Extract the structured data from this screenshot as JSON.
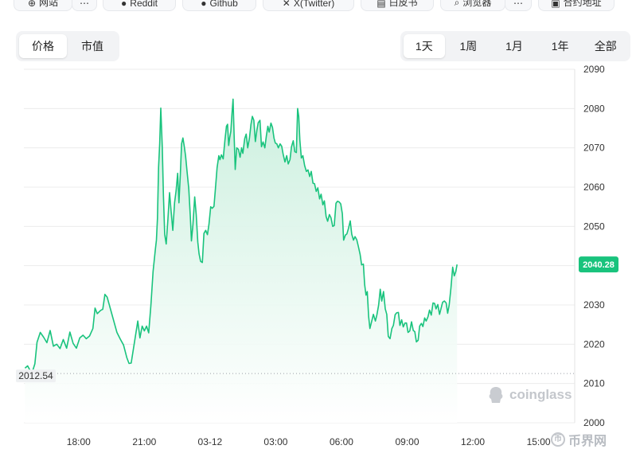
{
  "top_links": [
    {
      "label": "网站",
      "icon": "globe-icon"
    },
    {
      "label": "",
      "icon": "more-icon"
    },
    {
      "label": "Reddit",
      "icon": "reddit-icon"
    },
    {
      "label": "Github",
      "icon": "github-icon"
    },
    {
      "label": "X(Twitter)",
      "icon": "x-icon"
    },
    {
      "label": "白皮书",
      "icon": "document-icon"
    },
    {
      "label": "浏览器",
      "icon": "search-icon"
    },
    {
      "label": "",
      "icon": "more-icon"
    },
    {
      "label": "合约地址",
      "icon": "clipboard-icon"
    }
  ],
  "metric_tabs": [
    {
      "label": "价格",
      "active": true
    },
    {
      "label": "市值",
      "active": false
    }
  ],
  "range_tabs": [
    {
      "label": "1天",
      "active": true
    },
    {
      "label": "1周",
      "active": false
    },
    {
      "label": "1月",
      "active": false
    },
    {
      "label": "1年",
      "active": false
    },
    {
      "label": "全部",
      "active": false
    }
  ],
  "watermark": {
    "text": "coinglass",
    "icon": "coinglass-logo-icon"
  },
  "site_mark": {
    "text": "币界网",
    "icon": "coin-icon"
  },
  "colors": {
    "line": "#19c37d",
    "area_top": "#c9efdd",
    "area_bottom": "#ffffff",
    "badge": "#19c37d",
    "grid": "#ececec"
  },
  "chart_data": {
    "type": "area",
    "title": "",
    "xlabel": "",
    "ylabel": "",
    "ylim": [
      2000,
      2090
    ],
    "y_ticks": [
      2090,
      2080,
      2070,
      2060,
      2050,
      2040,
      2030,
      2020,
      2010,
      2000
    ],
    "y_axis_side": "right",
    "grid": true,
    "x_ticks": [
      {
        "label": "18:00",
        "x": 3
      },
      {
        "label": "21:00",
        "x": 6
      },
      {
        "label": "03-12",
        "x": 9
      },
      {
        "label": "03:00",
        "x": 12
      },
      {
        "label": "06:00",
        "x": 15
      },
      {
        "label": "09:00",
        "x": 18
      },
      {
        "label": "12:00",
        "x": 21
      },
      {
        "label": "15:00",
        "x": 24
      }
    ],
    "x_range": [
      0.5,
      25.65
    ],
    "last_value_label": "2040.28",
    "baseline": {
      "value": 2012.54,
      "label": "2012.54"
    },
    "series": [
      {
        "name": "",
        "points": [
          [
            0.55,
            2013.9
          ],
          [
            0.67,
            2014.5
          ],
          [
            0.86,
            2012.5
          ],
          [
            1.0,
            2015.0
          ],
          [
            1.1,
            2020.5
          ],
          [
            1.25,
            2023.0
          ],
          [
            1.4,
            2021.8
          ],
          [
            1.55,
            2020.4
          ],
          [
            1.7,
            2023.5
          ],
          [
            1.85,
            2019.5
          ],
          [
            2.0,
            2020.0
          ],
          [
            2.15,
            2018.9
          ],
          [
            2.3,
            2021.2
          ],
          [
            2.45,
            2019.0
          ],
          [
            2.6,
            2023.1
          ],
          [
            2.75,
            2020.2
          ],
          [
            2.9,
            2019.0
          ],
          [
            3.05,
            2021.6
          ],
          [
            3.2,
            2022.3
          ],
          [
            3.35,
            2021.4
          ],
          [
            3.5,
            2022.1
          ],
          [
            3.65,
            2024.0
          ],
          [
            3.75,
            2029.2
          ],
          [
            3.85,
            2027.8
          ],
          [
            4.0,
            2028.6
          ],
          [
            4.1,
            2028.9
          ],
          [
            4.2,
            2032.7
          ],
          [
            4.3,
            2032.0
          ],
          [
            4.45,
            2029.0
          ],
          [
            4.6,
            2026.0
          ],
          [
            4.75,
            2023.0
          ],
          [
            4.9,
            2021.3
          ],
          [
            5.05,
            2019.8
          ],
          [
            5.2,
            2016.6
          ],
          [
            5.3,
            2015.1
          ],
          [
            5.4,
            2015.2
          ],
          [
            5.55,
            2020.6
          ],
          [
            5.7,
            2025.9
          ],
          [
            5.8,
            2021.6
          ],
          [
            5.9,
            2024.6
          ],
          [
            6.0,
            2023.4
          ],
          [
            6.1,
            2024.6
          ],
          [
            6.2,
            2022.9
          ],
          [
            6.3,
            2030.0
          ],
          [
            6.4,
            2038.5
          ],
          [
            6.5,
            2044.0
          ],
          [
            6.55,
            2046.5
          ],
          [
            6.6,
            2052.0
          ],
          [
            6.65,
            2065.0
          ],
          [
            6.7,
            2071.0
          ],
          [
            6.75,
            2080.1
          ],
          [
            6.82,
            2070.0
          ],
          [
            6.87,
            2058.0
          ],
          [
            6.93,
            2048.0
          ],
          [
            7.0,
            2045.5
          ],
          [
            7.08,
            2052.0
          ],
          [
            7.15,
            2058.6
          ],
          [
            7.22,
            2054.0
          ],
          [
            7.3,
            2049.0
          ],
          [
            7.38,
            2056.0
          ],
          [
            7.45,
            2059.0
          ],
          [
            7.52,
            2063.5
          ],
          [
            7.58,
            2056.0
          ],
          [
            7.64,
            2063.0
          ],
          [
            7.7,
            2071.0
          ],
          [
            7.76,
            2072.5
          ],
          [
            7.82,
            2070.5
          ],
          [
            7.88,
            2068.0
          ],
          [
            7.95,
            2064.0
          ],
          [
            8.03,
            2059.5
          ],
          [
            8.1,
            2052.5
          ],
          [
            8.15,
            2046.3
          ],
          [
            8.22,
            2050.5
          ],
          [
            8.3,
            2057.5
          ],
          [
            8.37,
            2053.0
          ],
          [
            8.44,
            2046.0
          ],
          [
            8.5,
            2043.0
          ],
          [
            8.57,
            2041.1
          ],
          [
            8.65,
            2040.8
          ],
          [
            8.72,
            2048.2
          ],
          [
            8.8,
            2049.0
          ],
          [
            8.88,
            2047.9
          ],
          [
            8.95,
            2050.5
          ],
          [
            9.03,
            2055.0
          ],
          [
            9.1,
            2054.6
          ],
          [
            9.18,
            2055.1
          ],
          [
            9.25,
            2060.0
          ],
          [
            9.32,
            2064.9
          ],
          [
            9.4,
            2068.0
          ],
          [
            9.45,
            2067.0
          ],
          [
            9.52,
            2068.2
          ],
          [
            9.6,
            2067.2
          ],
          [
            9.68,
            2072.0
          ],
          [
            9.75,
            2075.5
          ],
          [
            9.8,
            2076.0
          ],
          [
            9.85,
            2070.6
          ],
          [
            9.9,
            2072.6
          ],
          [
            9.95,
            2074.2
          ],
          [
            10.0,
            2078.6
          ],
          [
            10.05,
            2082.4
          ],
          [
            10.1,
            2073.4
          ],
          [
            10.15,
            2064.5
          ],
          [
            10.22,
            2070.0
          ],
          [
            10.3,
            2069.6
          ],
          [
            10.37,
            2067.6
          ],
          [
            10.44,
            2070.0
          ],
          [
            10.5,
            2068.6
          ],
          [
            10.58,
            2072.3
          ],
          [
            10.65,
            2073.5
          ],
          [
            10.72,
            2070.0
          ],
          [
            10.8,
            2072.5
          ],
          [
            10.87,
            2076.0
          ],
          [
            10.93,
            2078.0
          ],
          [
            11.0,
            2077.0
          ],
          [
            11.07,
            2071.6
          ],
          [
            11.14,
            2074.6
          ],
          [
            11.2,
            2076.4
          ],
          [
            11.28,
            2077.0
          ],
          [
            11.35,
            2070.3
          ],
          [
            11.42,
            2071.5
          ],
          [
            11.5,
            2070.0
          ],
          [
            11.57,
            2073.0
          ],
          [
            11.64,
            2075.5
          ],
          [
            11.7,
            2074.0
          ],
          [
            11.78,
            2076.3
          ],
          [
            11.85,
            2075.2
          ],
          [
            11.92,
            2072.5
          ],
          [
            11.98,
            2071.2
          ],
          [
            12.05,
            2071.0
          ],
          [
            12.12,
            2070.0
          ],
          [
            12.2,
            2071.0
          ],
          [
            12.27,
            2070.4
          ],
          [
            12.34,
            2068.3
          ],
          [
            12.42,
            2066.4
          ],
          [
            12.5,
            2068.0
          ],
          [
            12.57,
            2065.9
          ],
          [
            12.65,
            2067.0
          ],
          [
            12.72,
            2070.3
          ],
          [
            12.8,
            2071.8
          ],
          [
            12.87,
            2069.0
          ],
          [
            12.94,
            2068.8
          ],
          [
            13.0,
            2080.0
          ],
          [
            13.05,
            2078.0
          ],
          [
            13.1,
            2072.0
          ],
          [
            13.17,
            2067.4
          ],
          [
            13.24,
            2068.0
          ],
          [
            13.32,
            2065.5
          ],
          [
            13.4,
            2064.0
          ],
          [
            13.47,
            2064.4
          ],
          [
            13.55,
            2062.7
          ],
          [
            13.62,
            2064.0
          ],
          [
            13.7,
            2061.0
          ],
          [
            13.77,
            2060.9
          ],
          [
            13.85,
            2058.9
          ],
          [
            13.92,
            2059.8
          ],
          [
            14.0,
            2057.0
          ],
          [
            14.07,
            2058.2
          ],
          [
            14.15,
            2055.5
          ],
          [
            14.22,
            2056.5
          ],
          [
            14.3,
            2052.5
          ],
          [
            14.37,
            2051.3
          ],
          [
            14.45,
            2053.0
          ],
          [
            14.52,
            2052.2
          ],
          [
            14.6,
            2050.0
          ],
          [
            14.67,
            2050.2
          ],
          [
            14.75,
            2055.9
          ],
          [
            14.82,
            2056.4
          ],
          [
            14.9,
            2056.2
          ],
          [
            14.97,
            2055.7
          ],
          [
            15.04,
            2053.2
          ],
          [
            15.1,
            2046.5
          ],
          [
            15.18,
            2047.8
          ],
          [
            15.25,
            2048.1
          ],
          [
            15.32,
            2049.5
          ],
          [
            15.4,
            2051.4
          ],
          [
            15.47,
            2048.0
          ],
          [
            15.55,
            2046.5
          ],
          [
            15.62,
            2047.4
          ],
          [
            15.7,
            2046.6
          ],
          [
            15.77,
            2044.9
          ],
          [
            15.85,
            2042.9
          ],
          [
            15.92,
            2040.2
          ],
          [
            16.0,
            2040.4
          ],
          [
            16.06,
            2035.2
          ],
          [
            16.12,
            2032.5
          ],
          [
            16.18,
            2033.4
          ],
          [
            16.24,
            2027.1
          ],
          [
            16.3,
            2024.0
          ],
          [
            16.38,
            2025.8
          ],
          [
            16.46,
            2027.6
          ],
          [
            16.55,
            2025.9
          ],
          [
            16.62,
            2027.5
          ],
          [
            16.7,
            2030.0
          ],
          [
            16.77,
            2034.0
          ],
          [
            16.84,
            2031.0
          ],
          [
            16.92,
            2033.4
          ],
          [
            17.0,
            2029.0
          ],
          [
            17.07,
            2027.6
          ],
          [
            17.14,
            2022.0
          ],
          [
            17.22,
            2021.4
          ],
          [
            17.3,
            2024.0
          ],
          [
            17.37,
            2024.8
          ],
          [
            17.45,
            2027.5
          ],
          [
            17.52,
            2028.0
          ],
          [
            17.6,
            2028.1
          ],
          [
            17.67,
            2024.8
          ],
          [
            17.75,
            2026.2
          ],
          [
            17.82,
            2024.4
          ],
          [
            17.9,
            2025.4
          ],
          [
            17.97,
            2025.4
          ],
          [
            18.04,
            2023.0
          ],
          [
            18.12,
            2023.4
          ],
          [
            18.2,
            2025.7
          ],
          [
            18.28,
            2023.5
          ],
          [
            18.35,
            2023.2
          ],
          [
            18.42,
            2020.6
          ],
          [
            18.5,
            2021.0
          ],
          [
            18.57,
            2024.6
          ],
          [
            18.65,
            2025.3
          ],
          [
            18.72,
            2024.5
          ],
          [
            18.8,
            2026.7
          ],
          [
            18.87,
            2025.9
          ],
          [
            18.95,
            2027.0
          ],
          [
            19.02,
            2028.7
          ],
          [
            19.1,
            2027.4
          ],
          [
            19.18,
            2030.5
          ],
          [
            19.25,
            2030.4
          ],
          [
            19.32,
            2029.0
          ],
          [
            19.4,
            2030.1
          ],
          [
            19.48,
            2027.6
          ],
          [
            19.55,
            2029.2
          ],
          [
            19.62,
            2030.7
          ],
          [
            19.7,
            2031.0
          ],
          [
            19.78,
            2030.5
          ],
          [
            19.85,
            2027.9
          ],
          [
            19.92,
            2030.0
          ],
          [
            20.0,
            2034.3
          ],
          [
            20.08,
            2039.6
          ],
          [
            20.15,
            2037.4
          ],
          [
            20.22,
            2038.5
          ],
          [
            20.28,
            2040.3
          ]
        ]
      }
    ]
  }
}
